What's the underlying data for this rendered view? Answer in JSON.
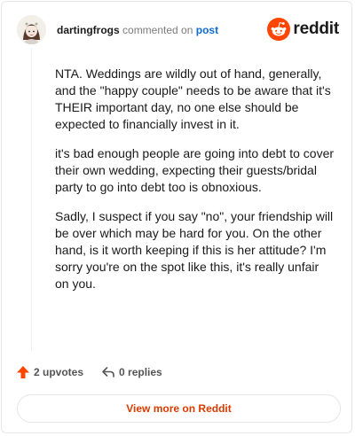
{
  "header": {
    "username": "dartingfrogs",
    "action_text": "commented on",
    "post_link": "post",
    "brand": "reddit"
  },
  "comment": {
    "paragraphs": [
      "NTA. Weddings are wildly out of hand, generally, and the \"happy couple\" needs to be aware that it's THEIR important day, no one else should be expected to financially invest in it.",
      "it's bad enough people are going into debt to cover their own wedding, expecting their guests/bridal party to go into debt too is obnoxious.",
      "Sadly, I suspect if you say \"no\", your friendship will be over which may be hard for you. On the other hand, is it worth keeping if this is her attitude? I'm sorry you're on the spot like this, it's really unfair on you."
    ]
  },
  "actions": {
    "upvotes": "2 upvotes",
    "replies": "0 replies"
  },
  "footer": {
    "view_more": "View more on Reddit"
  },
  "colors": {
    "brand": "#ff4500",
    "link": "#0f6bd1",
    "cta": "#d93a00"
  },
  "icons": [
    "avatar",
    "reddit-logo-icon",
    "upvote-arrow-icon",
    "reply-icon"
  ]
}
